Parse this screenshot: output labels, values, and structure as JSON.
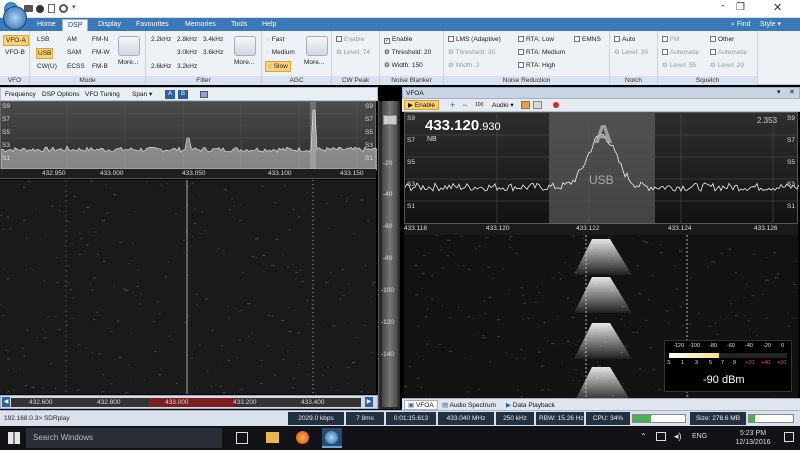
{
  "window": {
    "title_actions": [
      "Find",
      "Style"
    ]
  },
  "menu": [
    "Home",
    "DSP",
    "Display",
    "Favourites",
    "Memories",
    "Tools",
    "Help"
  ],
  "ribbon": {
    "vfo": {
      "items": [
        "VFO-A",
        "VFO-B"
      ],
      "label": "VFO"
    },
    "mode": {
      "col1": [
        "LSB",
        "USB",
        "CW(U)"
      ],
      "col2": [
        "AM",
        "SAM",
        "ECSS"
      ],
      "col3": [
        "FM-N",
        "FM-W",
        "FM-B"
      ],
      "more": "More...",
      "label": "Mode"
    },
    "filter": {
      "col1": [
        "2.2kHz",
        "2.6kHz"
      ],
      "col2": [
        "2.8kHz",
        "3.0kHz",
        "3.2kHz"
      ],
      "col3": [
        "3.4kHz",
        "3.6kHz"
      ],
      "more": "More...",
      "label": "Filter"
    },
    "agc": {
      "items": [
        "Fast",
        "Medium",
        "Slow"
      ],
      "more": "More...",
      "label": "AGC"
    },
    "cwpeak": {
      "enable": "Enable",
      "level": "Level: 74",
      "label": "CW Peak"
    },
    "nb": {
      "enable": "Enable",
      "threshold": "Threshold: 20",
      "width": "Width: 150",
      "label": "Noise Blanker"
    },
    "nr": {
      "lms": "LMS (Adaptive)",
      "threshold": "Threshold: 30",
      "width": "Width: 2",
      "rta_low": "RTA: Low",
      "rta_medium": "RTA: Medium",
      "rta_high": "RTA: High",
      "emns": "EMNS",
      "label": "Noise Reduction"
    },
    "notch": {
      "auto": "Auto",
      "level": "Level: 20",
      "label": "Notch"
    },
    "squelch": {
      "fm": "FM",
      "automatic1": "Automatic",
      "level55": "Level: 55",
      "other": "Other",
      "automatic2": "Automatic",
      "level20": "Level: 20",
      "label": "Squelch"
    }
  },
  "left_panel": {
    "toolbar": [
      "Frequency",
      "DSP Options",
      "VFO Tuning",
      "Span"
    ],
    "toggles": [
      "A",
      "B"
    ],
    "smeter_left": [
      "S9",
      "S7",
      "S5",
      "S3",
      "S1"
    ],
    "smeter_right": [
      "S9",
      "S7",
      "S5",
      "S3",
      "S1"
    ],
    "freq_ticks": [
      "432.950",
      "433.000",
      "433.050",
      "433.100",
      "433.150"
    ],
    "range_ticks": [
      "432.600",
      "432.800",
      "433.000",
      "433.200",
      "433.400"
    ]
  },
  "db_scale": [
    "-20",
    "-40",
    "-60",
    "-80",
    "-100",
    "-120",
    "-140"
  ],
  "right_panel": {
    "title": "VFOA",
    "toolbar": {
      "enable": "Enable",
      "zoom": "100",
      "audio": "Audio"
    },
    "frequency_main": "433.120",
    "frequency_sub": ".930",
    "nb_tag": "NB",
    "vfo_letter": "A",
    "mode_tag": "USB",
    "corner_value": "2.353",
    "smeter_left": [
      "S9",
      "S7",
      "S5",
      "S3",
      "S1"
    ],
    "smeter_right": [
      "S9",
      "S7",
      "S5",
      "S3",
      "S1"
    ],
    "freq_ticks": [
      "433.118",
      "433.120",
      "433.122",
      "433.124",
      "433.126"
    ],
    "tabs": [
      "VFOA",
      "Audio Spectrum",
      "Data Playback"
    ]
  },
  "smeter": {
    "dbm_scale": [
      "-120",
      "-100",
      "-80",
      "-60",
      "-40",
      "-20",
      "0"
    ],
    "s_scale": [
      "S",
      "1",
      "3",
      "5",
      "7",
      "9",
      "+20",
      "+40",
      "+60"
    ],
    "level": 0.42,
    "readout": "-90 dBm"
  },
  "status": {
    "device": "192.168.0.3> SDRplay",
    "bitrate": "2029.0 kbps",
    "latency": "7 8ms",
    "time": "0:01:15.613",
    "frequency": "433.040 MHz",
    "bandwidth": "250 kHz",
    "rbw": "RBW: 15.26 Hz",
    "cpu": "CPU: 34%",
    "cpu_level": 0.34,
    "size": "Size: 278.6 MB"
  },
  "taskbar": {
    "search": "Search Windows",
    "lang": "ENG",
    "clock_time": "5:23 PM",
    "clock_date": "12/13/2016"
  }
}
